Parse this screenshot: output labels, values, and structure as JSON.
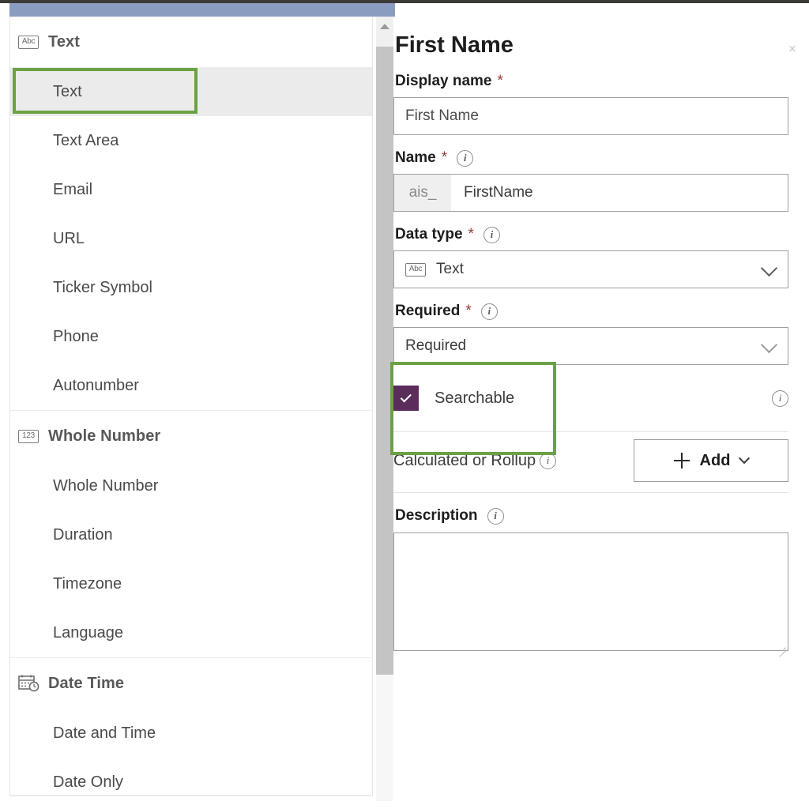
{
  "colors": {
    "accent_blue_bar": "#8a9cc0",
    "annotation_green": "#6ba143",
    "checkbox_purple": "#5b2d5b",
    "required_star_red": "#9b3a38",
    "selected_row_gray": "#ebebeb"
  },
  "type_picker": {
    "groups": [
      {
        "icon": "abc-icon",
        "icon_glyph": "Abc",
        "label": "Text",
        "items": [
          {
            "label": "Text",
            "selected": true,
            "highlighted": true
          },
          {
            "label": "Text Area",
            "selected": false,
            "highlighted": false
          },
          {
            "label": "Email",
            "selected": false,
            "highlighted": false
          },
          {
            "label": "URL",
            "selected": false,
            "highlighted": false
          },
          {
            "label": "Ticker Symbol",
            "selected": false,
            "highlighted": false
          },
          {
            "label": "Phone",
            "selected": false,
            "highlighted": false
          },
          {
            "label": "Autonumber",
            "selected": false,
            "highlighted": false
          }
        ]
      },
      {
        "icon": "number-123-icon",
        "icon_glyph": "123",
        "label": "Whole Number",
        "items": [
          {
            "label": "Whole Number",
            "selected": false,
            "highlighted": false
          },
          {
            "label": "Duration",
            "selected": false,
            "highlighted": false
          },
          {
            "label": "Timezone",
            "selected": false,
            "highlighted": false
          },
          {
            "label": "Language",
            "selected": false,
            "highlighted": false
          }
        ]
      },
      {
        "icon": "calendar-clock-icon",
        "icon_glyph": "",
        "label": "Date Time",
        "items": [
          {
            "label": "Date and Time",
            "selected": false,
            "highlighted": false
          },
          {
            "label": "Date Only",
            "selected": false,
            "highlighted": false
          }
        ]
      }
    ]
  },
  "properties_panel": {
    "title": "First Name",
    "close_label": "×",
    "display_name": {
      "label": "Display name",
      "required_marker": "*",
      "value": "First Name",
      "placeholder": "First Name"
    },
    "name": {
      "label": "Name",
      "required_marker": "*",
      "prefix": "ais_",
      "value": "FirstName",
      "has_info": true
    },
    "data_type": {
      "label": "Data type",
      "required_marker": "*",
      "value": "Text",
      "icon_glyph": "Abc",
      "has_info": true
    },
    "required": {
      "label": "Required",
      "required_marker": "*",
      "value": "Required",
      "has_info": true,
      "highlighted": true
    },
    "searchable": {
      "label": "Searchable",
      "checked": true,
      "has_info": true
    },
    "calculated_or_rollup": {
      "label": "Calculated or Rollup",
      "has_info": true,
      "add_button_label": "Add"
    },
    "description": {
      "label": "Description",
      "has_info": true,
      "value": "",
      "placeholder": ""
    }
  },
  "scrollbar": {
    "up_arrow": "scroll-up-arrow"
  }
}
